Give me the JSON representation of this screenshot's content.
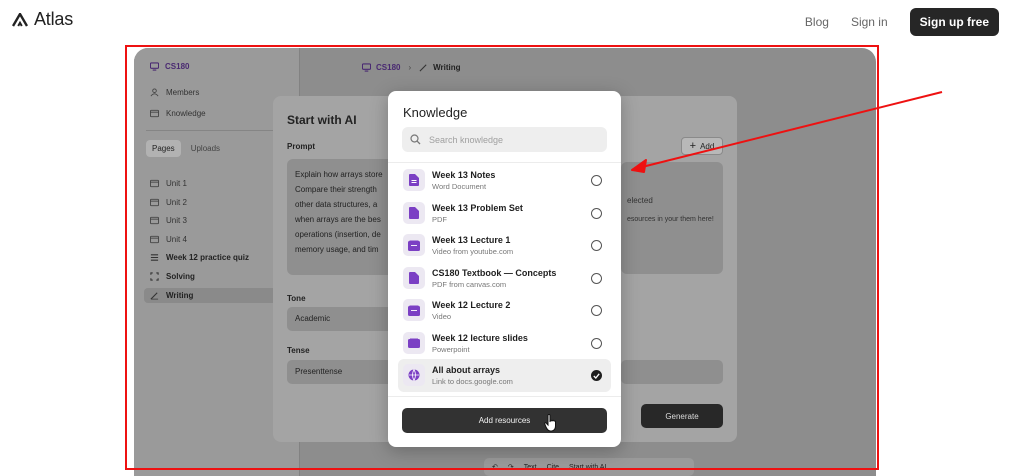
{
  "site": {
    "brand": "Atlas",
    "nav": {
      "blog": "Blog",
      "signin": "Sign in",
      "signup": "Sign up free"
    }
  },
  "sidebar": {
    "course": "CS180",
    "links": [
      {
        "label": "Members",
        "icon": "person-icon"
      },
      {
        "label": "Knowledge",
        "icon": "folder-icon"
      }
    ],
    "tabs": [
      "Pages",
      "Uploads"
    ],
    "items": [
      {
        "label": "Unit 1",
        "icon": "folder-icon"
      },
      {
        "label": "Unit 2",
        "icon": "folder-icon"
      },
      {
        "label": "Unit 3",
        "icon": "folder-icon"
      },
      {
        "label": "Unit 4",
        "icon": "folder-icon"
      },
      {
        "label": "Week 12 practice quiz",
        "icon": "list-icon"
      },
      {
        "label": "Solving",
        "icon": "scan-icon"
      },
      {
        "label": "Writing",
        "icon": "pen-icon"
      }
    ]
  },
  "breadcrumb": {
    "course": "CS180",
    "page": "Writing"
  },
  "ai_panel": {
    "title": "Start with AI",
    "prompt_label": "Prompt",
    "prompt_lines": [
      "Explain how arrays store",
      "Compare their strength",
      "other data structures, a",
      "when arrays are the bes",
      "operations (insertion, de",
      "memory usage, and tim"
    ],
    "tone_label": "Tone",
    "tone_value": "Academic",
    "tense_label": "Tense",
    "tense_value": "Presenttense",
    "add_label": "Add",
    "empty_title": "elected",
    "empty_desc": "esources in your them here!",
    "generate_label": "Generate"
  },
  "toolbar": {
    "text": "Text",
    "cite": "Cite",
    "start_ai": "Start with AI"
  },
  "knowledge_modal": {
    "title": "Knowledge",
    "search_placeholder": "Search knowledge",
    "resources": [
      {
        "title": "Week 13 Notes",
        "subtitle": "Word Document",
        "icon": "document-icon",
        "selected": false
      },
      {
        "title": "Week 13 Problem Set",
        "subtitle": "PDF",
        "icon": "document-icon",
        "selected": false
      },
      {
        "title": "Week 13 Lecture 1",
        "subtitle": "Video from youtube.com",
        "icon": "video-icon",
        "selected": false
      },
      {
        "title": "CS180 Textbook — Concepts",
        "subtitle": "PDF from canvas.com",
        "icon": "document-icon",
        "selected": false
      },
      {
        "title": "Week 12 Lecture 2",
        "subtitle": "Video",
        "icon": "video-icon",
        "selected": false
      },
      {
        "title": "Week 12 lecture slides",
        "subtitle": "Powerpoint",
        "icon": "slides-icon",
        "selected": false
      },
      {
        "title": "All about arrays",
        "subtitle": "Link to docs.google.com",
        "icon": "globe-icon",
        "selected": true
      }
    ],
    "add_button": "Add resources"
  },
  "colors": {
    "accent": "#7b3fc4",
    "highlight": "#e11111"
  }
}
